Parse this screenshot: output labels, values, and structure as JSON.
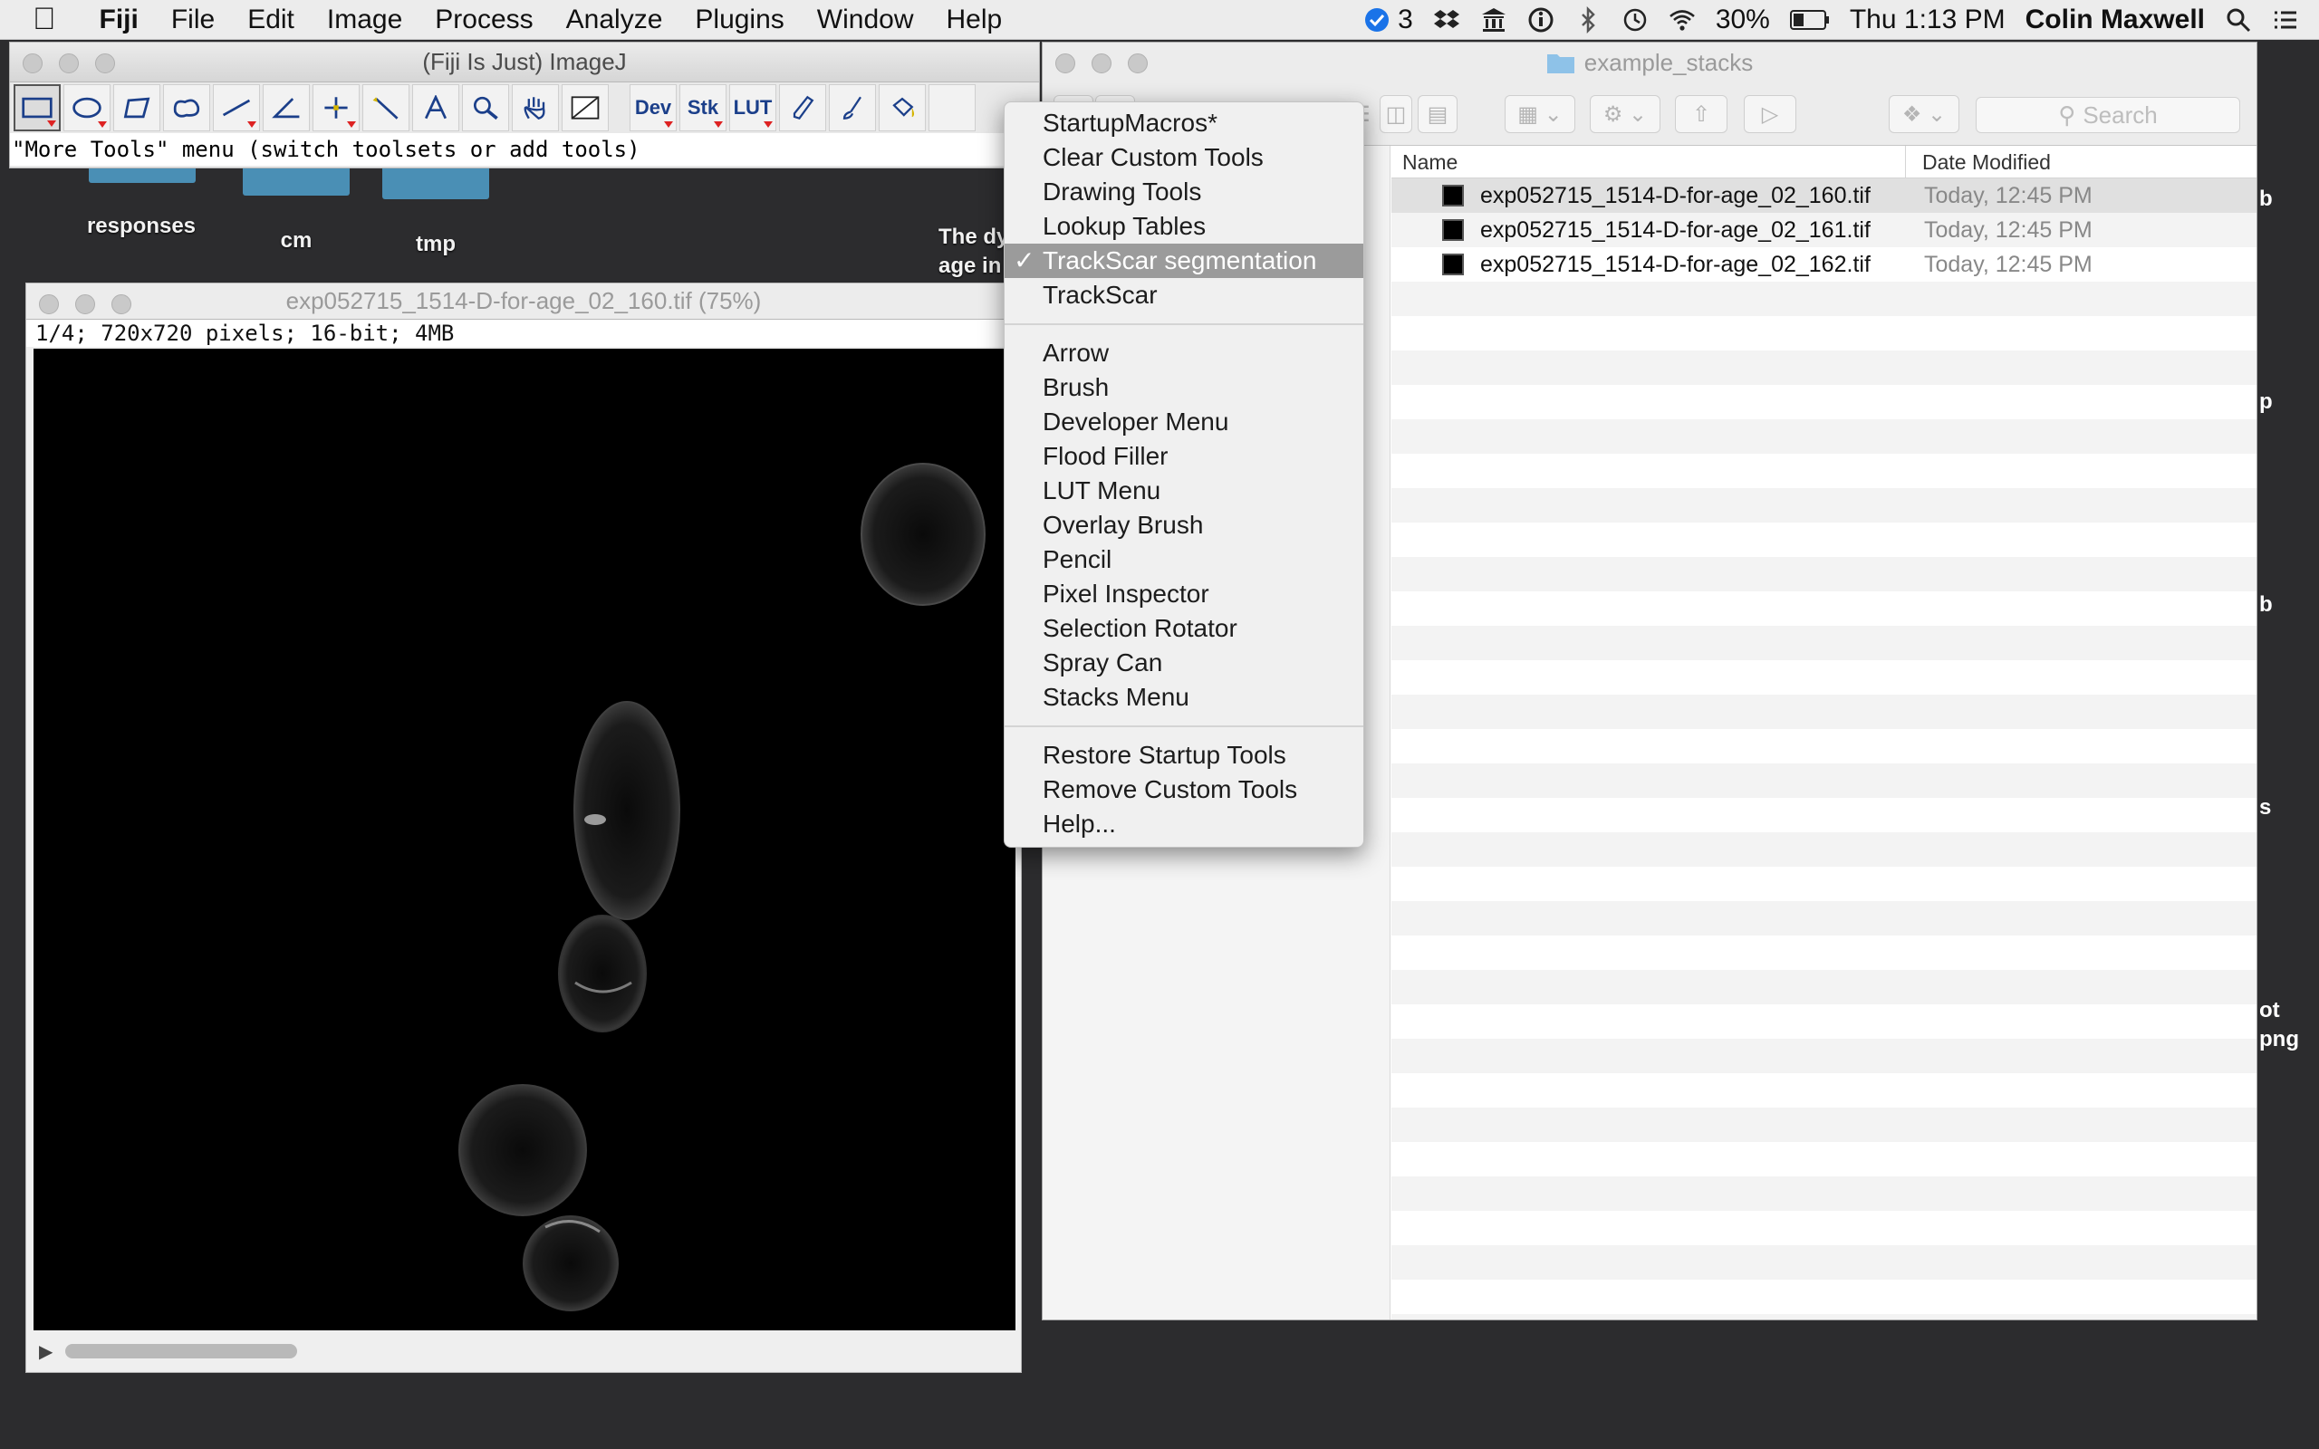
{
  "menubar": {
    "app_name": "Fiji",
    "menus": [
      "File",
      "Edit",
      "Image",
      "Process",
      "Analyze",
      "Plugins",
      "Window",
      "Help"
    ],
    "notification_count": "3",
    "battery": "30%",
    "clock": "Thu 1:13 PM",
    "user": "Colin Maxwell"
  },
  "desktop": {
    "items": [
      "responses",
      "cm",
      "tmp"
    ],
    "partial_text_line1": "The dy",
    "partial_text_line2": "age in",
    "right_edge_fragments": [
      "b",
      "p",
      "b",
      "s",
      "ot",
      "png"
    ]
  },
  "imagej": {
    "title": "(Fiji Is Just) ImageJ",
    "tools": [
      "rectangle-selection",
      "oval-selection",
      "polygon-selection",
      "freehand-selection",
      "line",
      "angle",
      "point",
      "wand",
      "text",
      "magnifier",
      "hand",
      "color-picker"
    ],
    "dev_label": "Dev",
    "stk_label": "Stk",
    "lut_label": "LUT",
    "status": "\"More Tools\" menu (switch toolsets or add tools)"
  },
  "image_window": {
    "title": "exp052715_1514-D-for-age_02_160.tif (75%)",
    "info": "1/4; 720x720 pixels; 16-bit; 4MB"
  },
  "finder": {
    "title": "example_stacks",
    "search_placeholder": "Search",
    "columns": [
      "Name",
      "Date Modified"
    ],
    "files": [
      {
        "name": "exp052715_1514-D-for-age_02_160.tif",
        "date": "Today, 12:45 PM"
      },
      {
        "name": "exp052715_1514-D-for-age_02_161.tif",
        "date": "Today, 12:45 PM"
      },
      {
        "name": "exp052715_1514-D-for-age_02_162.tif",
        "date": "Today, 12:45 PM"
      }
    ]
  },
  "more_tools_menu": {
    "group1": [
      "StartupMacros*",
      "Clear Custom Tools",
      "Drawing Tools",
      "Lookup Tables",
      "TrackScar segmentation",
      "TrackScar"
    ],
    "checked_item": "TrackScar segmentation",
    "group2": [
      "Arrow",
      "Brush",
      "Developer Menu",
      "Flood Filler",
      "LUT Menu",
      "Overlay Brush",
      "Pencil",
      "Pixel Inspector",
      "Selection Rotator",
      "Spray Can",
      "Stacks Menu"
    ],
    "group3": [
      "Restore Startup Tools",
      "Remove Custom Tools",
      "Help..."
    ],
    "check_glyph": "✓"
  }
}
